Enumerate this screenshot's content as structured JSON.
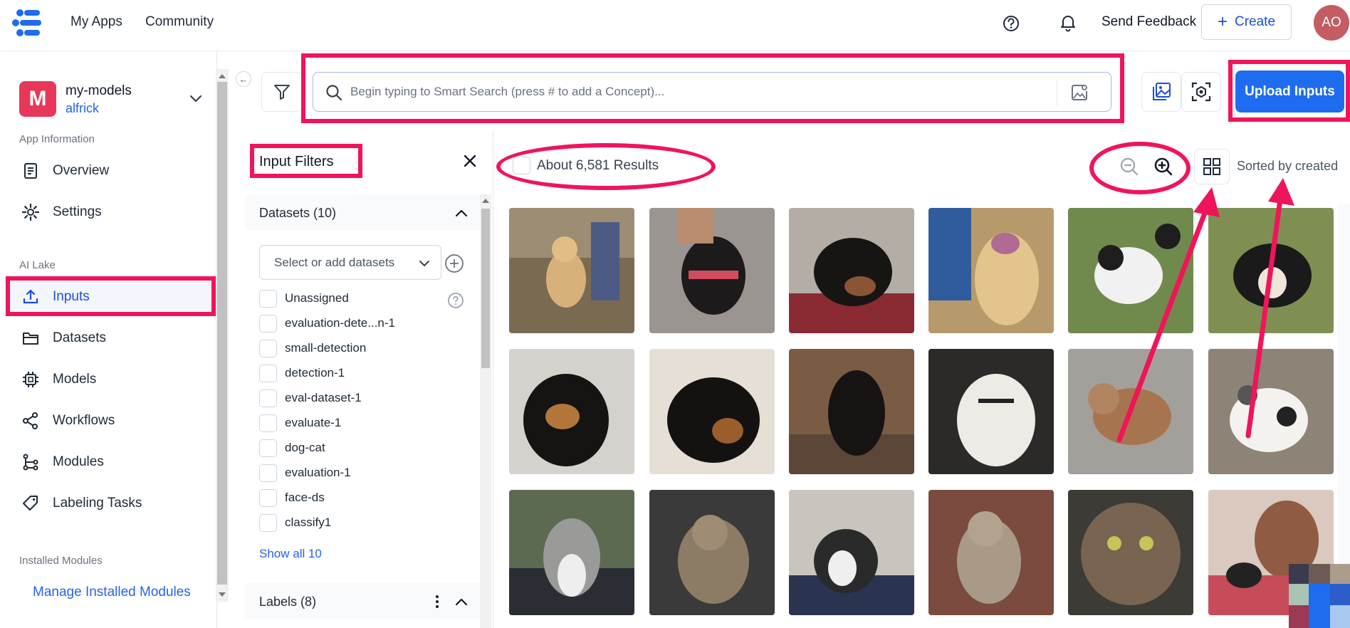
{
  "topbar": {
    "nav": [
      "My Apps",
      "Community"
    ],
    "send_feedback": "Send Feedback",
    "create_label": "Create",
    "avatar_initials": "AO"
  },
  "sidebar": {
    "app_badge": "M",
    "app_name": "my-models",
    "app_user": "alfrick",
    "section_app_info": "App Information",
    "items_app_info": [
      {
        "label": "Overview",
        "icon": "document-icon"
      },
      {
        "label": "Settings",
        "icon": "gear-icon"
      }
    ],
    "section_ai_lake": "AI Lake",
    "items_ai_lake": [
      {
        "label": "Inputs",
        "icon": "upload-icon",
        "active": true
      },
      {
        "label": "Datasets",
        "icon": "folder-icon"
      },
      {
        "label": "Models",
        "icon": "chip-icon"
      },
      {
        "label": "Workflows",
        "icon": "share-icon"
      },
      {
        "label": "Modules",
        "icon": "branch-icon"
      },
      {
        "label": "Labeling Tasks",
        "icon": "tag-icon"
      }
    ],
    "section_installed": "Installed Modules",
    "manage_link": "Manage Installed Modules"
  },
  "search": {
    "placeholder": "Begin typing to Smart Search (press # to add a Concept)...",
    "value": ""
  },
  "upload_button": "Upload Inputs",
  "filters": {
    "title": "Input Filters",
    "datasets_title": "Datasets (10)",
    "datasets_select_placeholder": "Select or add datasets",
    "datasets": [
      "Unassigned",
      "evaluation-dete...n-1",
      "small-detection",
      "detection-1",
      "eval-dataset-1",
      "evaluate-1",
      "dog-cat",
      "evaluation-1",
      "face-ds",
      "classify1"
    ],
    "show_all": "Show all 10",
    "labels_title": "Labels (8)"
  },
  "results": {
    "count_text": "About 6,581 Results",
    "sorted_text": "Sorted by created"
  },
  "colors": {
    "accent": "#1e6cf0",
    "annotation": "#f0145a",
    "app_badge": "#e8385a",
    "avatar": "#c45d62"
  }
}
